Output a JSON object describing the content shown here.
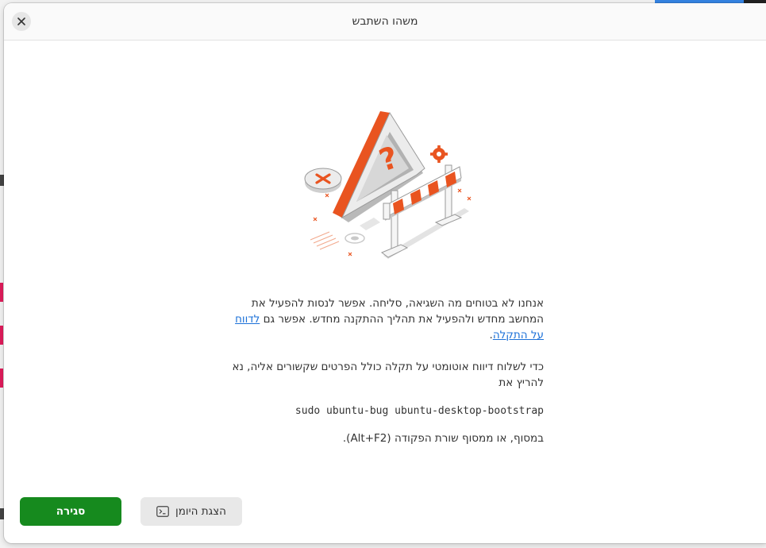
{
  "dialog": {
    "title": "משהו השתבש",
    "close_label": "×"
  },
  "message": {
    "line1": "אנחנו לא בטוחים מה השגיאה, סליחה. אפשר לנסות להפעיל את המחשב מחדש ולהפעיל את תהליך ההתקנה מחדש. אפשר גם ",
    "report_link": "לדווח על התקלה",
    "line1_end": ".",
    "line2": "כדי לשלוח דיווח אוטומטי על תקלה כולל הפרטים שקשורים אליה, נא להריץ את",
    "command": "sudo ubuntu-bug ubuntu-desktop-bootstrap",
    "hint": "במסוף, או ממסוף שורת הפקודה (Alt+F2)."
  },
  "buttons": {
    "close_label": "סגירה",
    "show_log_label": "הצגת היומן"
  },
  "icons": {
    "close": "close-icon",
    "terminal": "terminal-icon",
    "illustration": "warning-barrier-illustration"
  },
  "colors": {
    "accent_green": "#168a1e",
    "link": "#1c71d8",
    "warning_orange": "#e95420"
  }
}
